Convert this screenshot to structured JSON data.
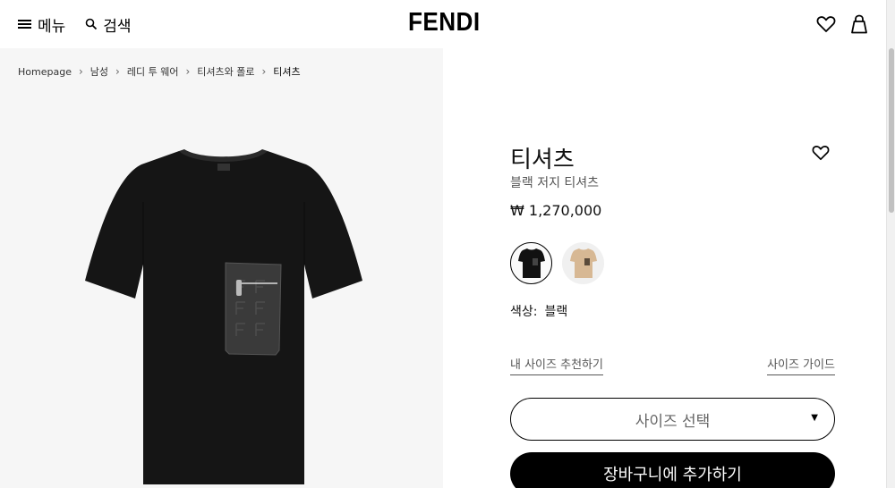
{
  "header": {
    "menu_label": "메뉴",
    "search_label": "검색",
    "logo": "FENDI"
  },
  "breadcrumb": [
    "Homepage",
    "남성",
    "레디 투 웨어",
    "티셔츠와 폴로",
    "티셔츠"
  ],
  "product": {
    "title": "티셔츠",
    "subtitle": "블랙 저지 티셔츠",
    "price": "₩ 1,270,000",
    "color_label": "색상:",
    "color_value": "블랙",
    "swatches": [
      {
        "name": "블랙",
        "color": "#111111",
        "selected": true
      },
      {
        "name": "베이지",
        "color": "#d7b894",
        "selected": false
      }
    ]
  },
  "size": {
    "recommend_link": "내 사이즈 추천하기",
    "guide_link": "사이즈 가이드",
    "select_label": "사이즈 선택"
  },
  "cart": {
    "add_label": "장바구니에 추가하기"
  },
  "colors": {
    "background": "#ffffff",
    "image_bg": "#f6f6f6",
    "primary": "#000000"
  }
}
